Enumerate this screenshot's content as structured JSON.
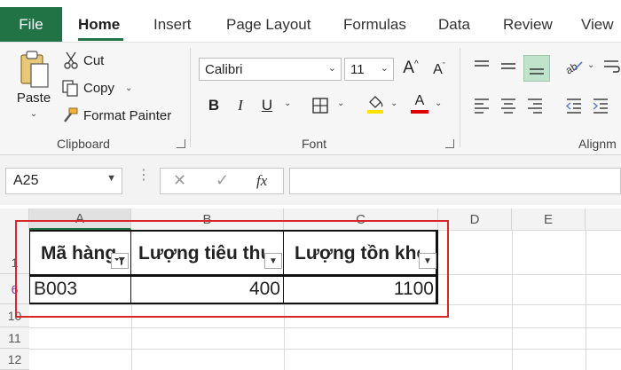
{
  "tabs": {
    "file": "File",
    "items": [
      "Home",
      "Insert",
      "Page Layout",
      "Formulas",
      "Data",
      "Review",
      "View"
    ],
    "active": "Home"
  },
  "clipboard": {
    "paste": "Paste",
    "cut": "Cut",
    "copy": "Copy",
    "format_painter": "Format Painter",
    "group_label": "Clipboard"
  },
  "font": {
    "family": "Calibri",
    "size": "11",
    "bold": "B",
    "italic": "I",
    "underline": "U",
    "group_label": "Font",
    "highlight_color": "#FFE100",
    "font_color": "#E00000",
    "grow_label": "A",
    "shrink_label": "A",
    "font_color_label": "A"
  },
  "alignment": {
    "group_label": "Alignm"
  },
  "formula_bar": {
    "name_box": "A25",
    "fx": "fx",
    "formula": ""
  },
  "columns": [
    "A",
    "B",
    "C",
    "D",
    "E"
  ],
  "rows": [
    "6",
    "10",
    "11",
    "12"
  ],
  "row_top_partial": "1",
  "table": {
    "headers": [
      "Mã hàng",
      "Lượng tiêu thụ",
      "Lượng tồn kho"
    ],
    "row": [
      "B003",
      "400",
      "1100"
    ]
  },
  "colors": {
    "accent": "#217346",
    "annotation": "#D9262B"
  }
}
